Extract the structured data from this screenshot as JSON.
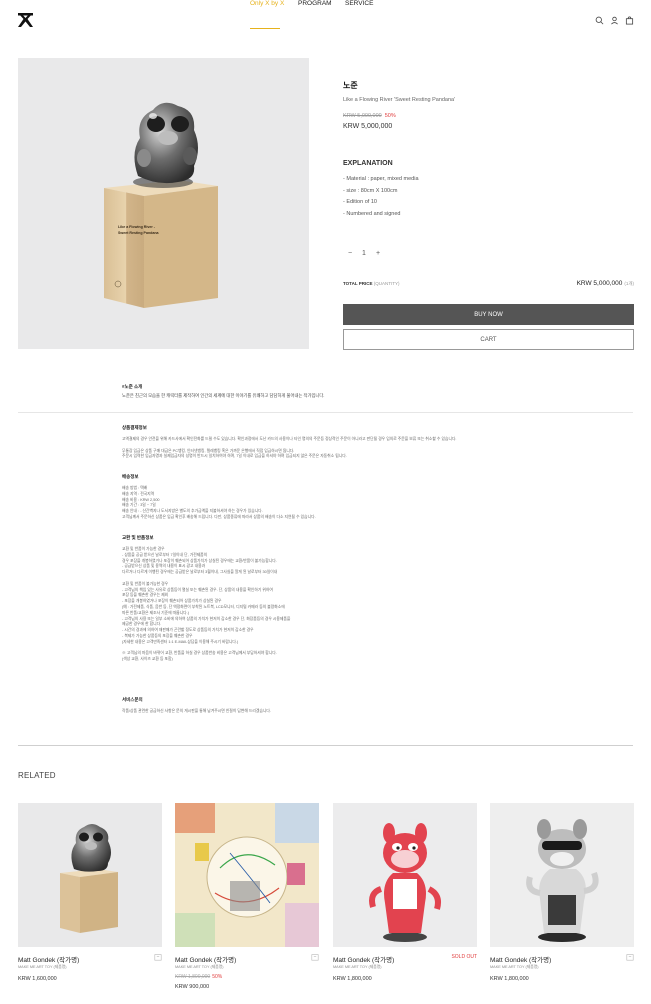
{
  "header": {
    "nav": [
      {
        "label": "Only X by X",
        "active": true
      },
      {
        "label": "PROGRAM",
        "active": false
      },
      {
        "label": "SERVICE",
        "active": false
      }
    ],
    "icons": [
      "search-icon",
      "user-icon",
      "cart-icon"
    ]
  },
  "product": {
    "title": "노준",
    "subtitle": "Like a Flowing River 'Sweet Resting Pandana'",
    "original_price": "KRW 5,000,000",
    "discount_rate": "50%",
    "price": "KRW 5,000,000",
    "box_text_1": "Like a Flowing River -",
    "box_text_2": "Sweet Resting Pandana",
    "explanation_title": "EXPLANATION",
    "explanation": [
      "- Material : paper, mixed media",
      "- size : 80cm X 100cm",
      "- Edition of 10",
      "- Numbered and signed"
    ],
    "quantity": "1",
    "total_label": "TOTAL PRICE",
    "total_qty": "(QUANTITY)",
    "total_price": "KRW 5,000,000",
    "total_unit": "(1개)",
    "buy_label": "BUY NOW",
    "cart_label": "CART"
  },
  "description": {
    "heading": "#노준 소개",
    "text": "노준은 친근의 모습을 한 캐릭터를 제작하여 인간의 세계에 대한 이야기를 유쾌하고 담담하게 풀어내는 작가입니다."
  },
  "info_sections": [
    {
      "title": "상품결제정보",
      "lines": [
        "고액결제의 경우 안전을 위해 카드사에서 확인전화를 드릴 수도 있습니다. 확인과정에서 도난 카드의 사용이나 타인 명의의 주문등 정상적인 주문이 아니라고 판단될 경우 임의로 주문을 보류 또는 취소할 수 있습니다.",
        "",
        "무통장 입금은 상품 구매 대금은 PC뱅킹, 인터넷뱅킹, 텔레뱅킹 혹은 가까운 은행에서 직접 입금하시면 됩니다.",
        "주문시 입력한 입금자명과 실제입금자의 성명이 반드시 일치하여야 하며, 7일 이내로 입금을 하셔야 하며 입금되지 않은 주문은 자동취소 됩니다."
      ]
    },
    {
      "title": "배송정보",
      "lines": [
        "배송 방법 : 택배",
        "배송 지역 : 전국지역",
        "배송 비용 : KRW 2,500",
        "배송 기간 : 3일 ~ 7일",
        "배송 안내 : - 산간벽지나 도서지방은 별도의 추가금액을 지불하셔야 하는 경우가 있습니다.",
        "고객님께서 주문하신 상품은 입금 확인후 배송해 드립니다. 다만, 상품종류에 따라서 상품의 배송이 다소 지연될 수 있습니다."
      ]
    },
    {
      "title": "교환 및 반품정보",
      "lines": [
        "교환 및 반품이 가능한 경우",
        "- 상품을 공급 받으신 날로부터 7일이내 단, 가전제품의",
        "  경우 포장을 개봉하였거나 포장이 훼손되어 상품가치가 상실된 경우에는 교환/반품이 불가능합니다.",
        "- 공급받으신 상품 및 용역의 내용이 표시.광고 내용과",
        "  다르거나 다르게 이행된 경우에는 공급받은 날로부터 3월이내, 그사실을 알게 된 날로부터 30일이내",
        "",
        "교환 및 반품이 불가능한 경우",
        "- 고객님의 책임 있는 사유로 상품등이 멸실 또는 훼손된 경우. 단, 상품의 내용을 확인하기 위하여",
        "  포장 등을 훼손한 경우는 제외",
        "- 포장을 개봉하였거나 포장이 훼손되어 상품가치가 상실된 경우",
        "  (예 : 가전제품, 식품, 음반 등, 단 액정화면이 부착된 노트북, LCD모니터, 디지털 카메라 등의 불량화소에",
        "  따른 반품/교환은 제조사 기준에 따릅니다.)",
        "- 고객님의 사용 또는 일부 소비에 의하여 상품의 가치가 현저히 감소한 경우 단, 화장품등의 경우 시용제품을",
        "  제공한 경우에 한 합니다.",
        "- 시간의 경과에 의하여 재판매가 곤란할 정도로 상품등의 가치가 현저히 감소한 경우",
        "- 복제가 가능한 상품등의 포장을 훼손한 경우",
        "  (자세한 내용은 고객만족센터 1:1 E-MAIL상담을 이용해 주시기 바랍니다.)",
        "",
        "※ 고객님의 마음이 바뀌어 교환, 반품을 하실 경우 상품반송 비용은 고객님께서 부담하셔야 합니다.",
        "  (색상 교환, 사이즈 교환 등 포함)"
      ]
    },
    {
      "title": "서비스문의",
      "lines": [
        "작품/상품 관련한 궁금하신 사항은 문의 게시판을 통해 남겨주시면 친절히 답변해 드리겠습니다."
      ]
    }
  ],
  "related": {
    "title": "RELATED",
    "items": [
      {
        "name": "Matt Gondek (작가명)",
        "category": "MAKE ME ART TOY (제품명)",
        "original": "",
        "rate": "",
        "price": "KRW 1,600,000",
        "sold_out": ""
      },
      {
        "name": "Matt Gondek (작가명)",
        "category": "MAKE ME ART TOY (제품명)",
        "original": "KRW 1,800,000",
        "rate": "50%",
        "price": "KRW 900,000",
        "sold_out": ""
      },
      {
        "name": "Matt Gondek (작가명)",
        "category": "MAKE ME ART TOY (제품명)",
        "original": "",
        "rate": "",
        "price": "KRW 1,800,000",
        "sold_out": "SOLD OUT"
      },
      {
        "name": "Matt Gondek (작가명)",
        "category": "MAKE ME ART TOY (제품명)",
        "original": "",
        "rate": "",
        "price": "KRW 1,800,000",
        "sold_out": ""
      }
    ]
  },
  "colors": {
    "accent": "#e6b21c",
    "sale": "#e03c3c",
    "button_dark": "#555555"
  }
}
